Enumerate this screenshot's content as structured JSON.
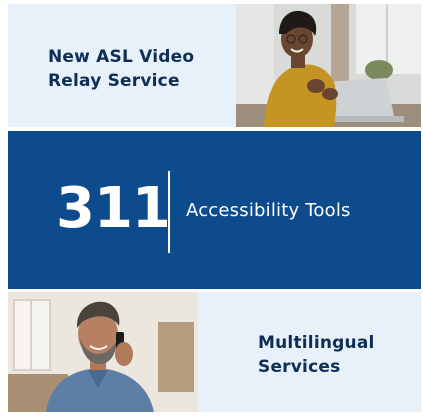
{
  "tiles": {
    "top": {
      "title": "New ASL Video Relay Service"
    },
    "middle": {
      "number": "311",
      "label": "Accessibility Tools"
    },
    "bottom": {
      "title": "Multilingual Services"
    }
  },
  "colors": {
    "brand_blue": "#0e4b8c",
    "light_blue": "#e8f0f9",
    "text_navy": "#0d2e57"
  },
  "images": {
    "top_photo": "woman-signing-at-laptop-photo",
    "bottom_photo": "man-on-phone-call-photo"
  }
}
